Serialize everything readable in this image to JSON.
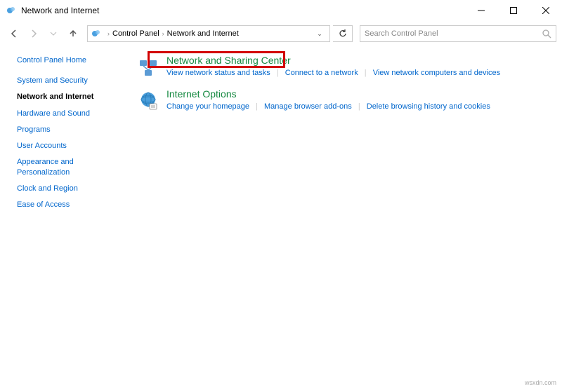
{
  "window": {
    "title": "Network and Internet"
  },
  "breadcrumb": {
    "root": "Control Panel",
    "current": "Network and Internet"
  },
  "search": {
    "placeholder": "Search Control Panel"
  },
  "sidebar": {
    "home": "Control Panel Home",
    "items": [
      "System and Security",
      "Network and Internet",
      "Hardware and Sound",
      "Programs",
      "User Accounts",
      "Appearance and Personalization",
      "Clock and Region",
      "Ease of Access"
    ],
    "activeIndex": 1
  },
  "categories": [
    {
      "title": "Network and Sharing Center",
      "links": [
        "View network status and tasks",
        "Connect to a network",
        "View network computers and devices"
      ]
    },
    {
      "title": "Internet Options",
      "links": [
        "Change your homepage",
        "Manage browser add-ons",
        "Delete browsing history and cookies"
      ]
    }
  ],
  "watermark": "wsxdn.com"
}
